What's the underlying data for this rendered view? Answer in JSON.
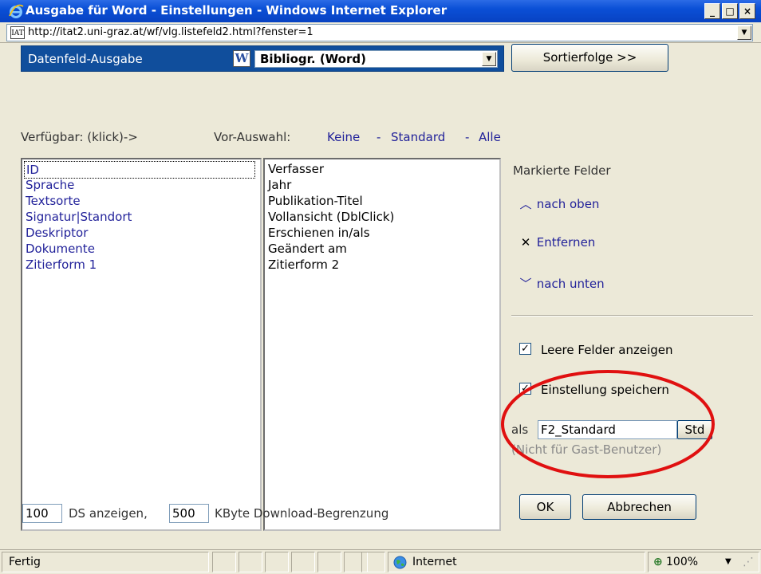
{
  "window": {
    "title": "Ausgabe für Word - Einstellungen - Windows Internet Explorer",
    "minimize": "_",
    "maximize": "□",
    "close": "×"
  },
  "address": {
    "icon_text": "IAT",
    "url": "http://itat2.uni-graz.at/wf/vlg.listefeld2.html?fenster=1"
  },
  "datenfeld": {
    "label": "Datenfeld-Ausgabe",
    "format_icon": "W",
    "format_value": "Bibliogr. (Word)"
  },
  "sort_button": "Sortierfolge >>",
  "available_label": "Verfügbar: (klick)->",
  "preselect": {
    "label": "Vor-Auswahl:",
    "none": "Keine",
    "sep1": "-",
    "standard": "Standard",
    "sep2": "-",
    "all": "Alle"
  },
  "available_fields": [
    "ID",
    "Sprache",
    "Textsorte",
    "Signatur|Standort",
    "Deskriptor",
    "Dokumente",
    "Zitierform 1"
  ],
  "selected_fields": [
    "Verfasser",
    "Jahr",
    "Publikation-Titel",
    "Vollansicht (DblClick)",
    "Erschienen in/als",
    "Geändert am",
    "Zitierform 2"
  ],
  "marked": {
    "label": "Markierte Felder",
    "up": "nach oben",
    "remove": "Entfernen",
    "down": "nach unten"
  },
  "options": {
    "show_empty": "Leere Felder anzeigen",
    "show_empty_checked": true,
    "save_setting": "Einstellung speichern",
    "save_setting_checked": true,
    "as_label": "als",
    "name_value": "F2_Standard",
    "std_button": "Std",
    "guest_note": "(Nicht für Gast-Benutzer)"
  },
  "buttons": {
    "ok": "OK",
    "cancel": "Abbrechen"
  },
  "limits": {
    "ds_value": "100",
    "ds_label": "DS anzeigen,",
    "kb_value": "500",
    "kb_label": "KByte Download-Begrenzung"
  },
  "status": {
    "text": "Fertig",
    "zone": "Internet",
    "zoom": "100%"
  },
  "colors": {
    "titlebar": "#0A4FD6",
    "datenfeld_bar": "#104E9C",
    "link": "#22229a",
    "annotation": "#E01010"
  }
}
